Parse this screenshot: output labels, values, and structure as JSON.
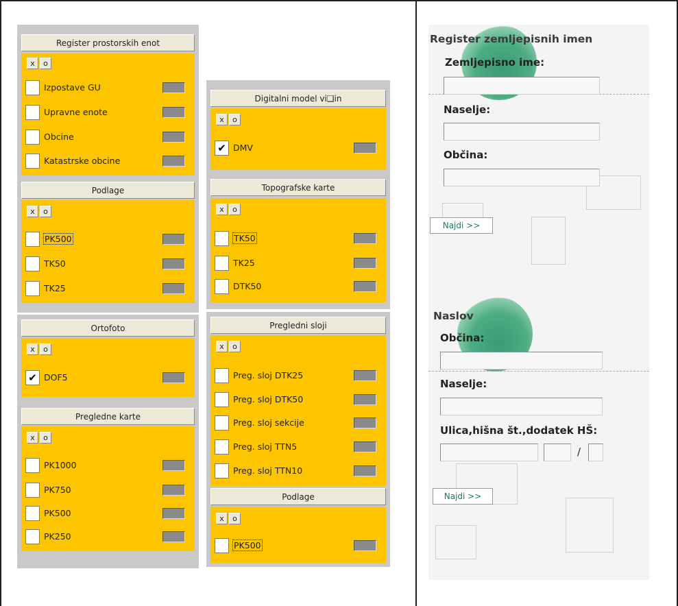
{
  "left_column": {
    "panels": [
      {
        "title": "Register prostorskih enot",
        "x_label": "x",
        "o_label": "o",
        "items": [
          {
            "label": "Izpostave GU",
            "checked": false
          },
          {
            "label": "Upravne enote",
            "checked": false
          },
          {
            "label": "Obcine",
            "checked": false
          },
          {
            "label": "Katastrske obcine",
            "checked": false
          }
        ]
      },
      {
        "title": "Podlage",
        "x_label": "x",
        "o_label": "o",
        "items": [
          {
            "label": "PK500",
            "checked": false
          },
          {
            "label": "TK50",
            "checked": false
          },
          {
            "label": "TK25",
            "checked": false
          }
        ]
      },
      {
        "title": "Ortofoto",
        "x_label": "x",
        "o_label": "o",
        "items": [
          {
            "label": "DOF5",
            "checked": true
          }
        ]
      },
      {
        "title": "Pregledne karte",
        "x_label": "x",
        "o_label": "o",
        "items": [
          {
            "label": "PK1000",
            "checked": false
          },
          {
            "label": "PK750",
            "checked": false
          },
          {
            "label": "PK500",
            "checked": false
          },
          {
            "label": "PK250",
            "checked": false
          }
        ]
      }
    ]
  },
  "right_column": {
    "panels": [
      {
        "title": "Digitalni model vi❑in",
        "x_label": "x",
        "o_label": "o",
        "items": [
          {
            "label": "DMV",
            "checked": true
          }
        ]
      },
      {
        "title": "Topografske karte",
        "x_label": "x",
        "o_label": "o",
        "items": [
          {
            "label": "TK50",
            "checked": false
          },
          {
            "label": "TK25",
            "checked": false
          },
          {
            "label": "DTK50",
            "checked": false
          }
        ]
      },
      {
        "title": "Pregledni sloji",
        "x_label": "x",
        "o_label": "o",
        "items": [
          {
            "label": "Preg. sloj DTK25",
            "checked": false
          },
          {
            "label": "Preg. sloj DTK50",
            "checked": false
          },
          {
            "label": "Preg. sloj sekcije",
            "checked": false
          },
          {
            "label": "Preg. sloj TTN5",
            "checked": false
          },
          {
            "label": "Preg. sloj TTN10",
            "checked": false
          }
        ]
      },
      {
        "title": "Podlage",
        "x_label": "x",
        "o_label": "o",
        "items": [
          {
            "label": "PK500",
            "checked": false
          }
        ]
      }
    ]
  },
  "check_mark": "✔",
  "search": {
    "names_form": {
      "title": "Register zemljepisnih imen",
      "field1_label": "Zemljepisno ime:",
      "field1_value": "",
      "field2_label": "Naselje:",
      "field2_value": "",
      "field3_label": "Občina:",
      "field3_value": "",
      "button": "Najdi >>"
    },
    "address_form": {
      "title": "Naslov",
      "field1_label": "Občina:",
      "field1_value": "",
      "field2_label": "Naselje:",
      "field2_value": "",
      "field3_label": "Ulica,hišna št.,dodatek HŠ:",
      "separator": "/",
      "button": "Najdi >>"
    }
  }
}
